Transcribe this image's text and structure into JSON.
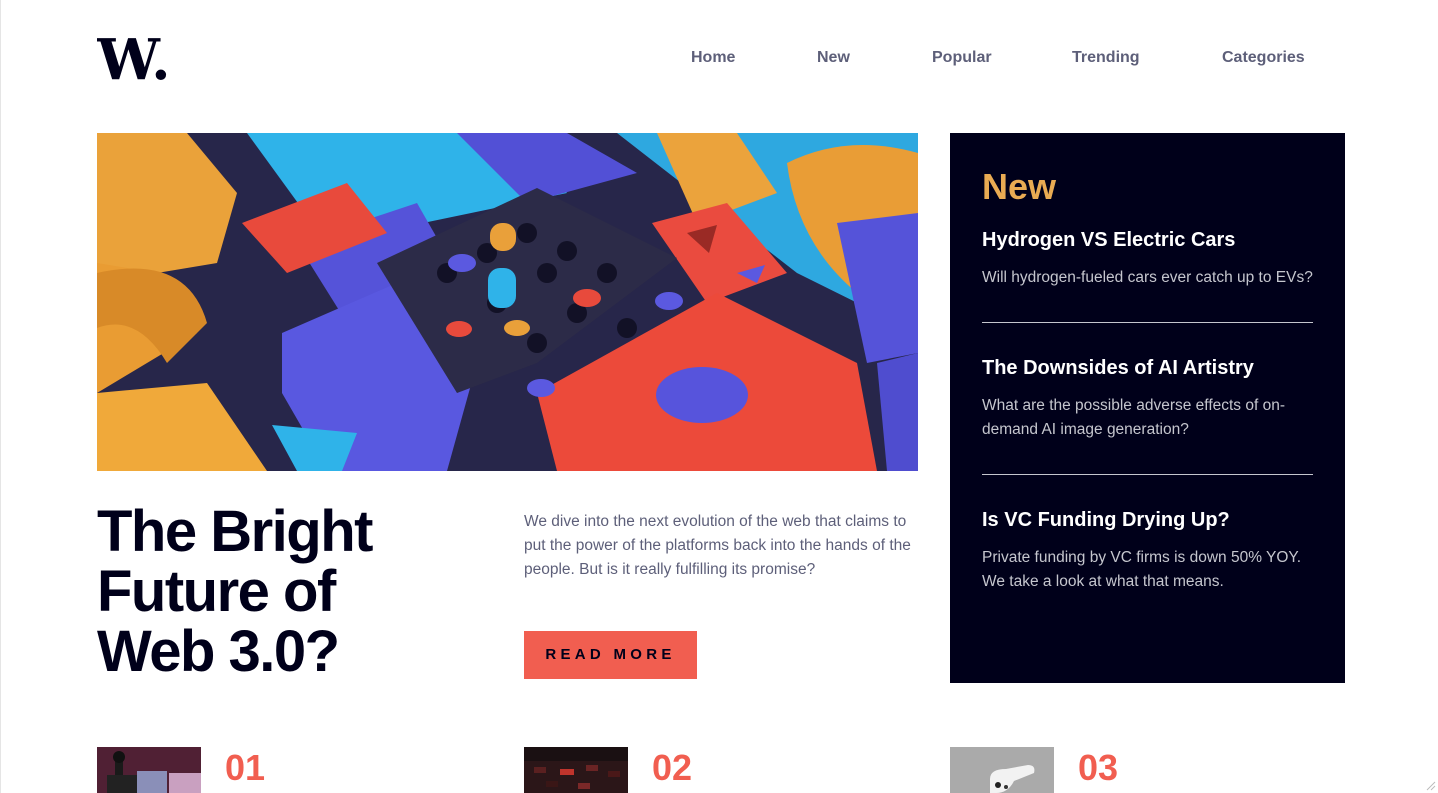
{
  "brand": {
    "logo_text": "W."
  },
  "nav": {
    "items": [
      "Home",
      "New",
      "Popular",
      "Trending",
      "Categories"
    ]
  },
  "hero": {
    "title_lines": [
      "The Bright",
      "Future of",
      "Web 3.0?"
    ],
    "description": "We dive into the next evolution of the web that claims to put the power of the platforms back into the hands of the people. But is it really fulfilling its promise?",
    "cta_label": "READ MORE"
  },
  "new_panel": {
    "heading": "New",
    "items": [
      {
        "title": "Hydrogen VS Electric Cars",
        "summary": "Will hydrogen-fueled cars ever catch up to EVs?"
      },
      {
        "title": "The Downsides of AI Artistry",
        "summary": "What are the possible adverse effects of on-demand AI image generation?"
      },
      {
        "title": "Is VC Funding Drying Up?",
        "summary": "Private funding by VC firms is down 50% YOY. We take a look at what that means."
      }
    ]
  },
  "top_list": {
    "items": [
      {
        "number": "01"
      },
      {
        "number": "02"
      },
      {
        "number": "03"
      }
    ]
  },
  "colors": {
    "accent_red": "#f15e50",
    "accent_orange": "#e9ab53",
    "dark_navy": "#00001a",
    "grayish_blue": "#5d5f79",
    "light_gray": "#c5c6ce"
  }
}
